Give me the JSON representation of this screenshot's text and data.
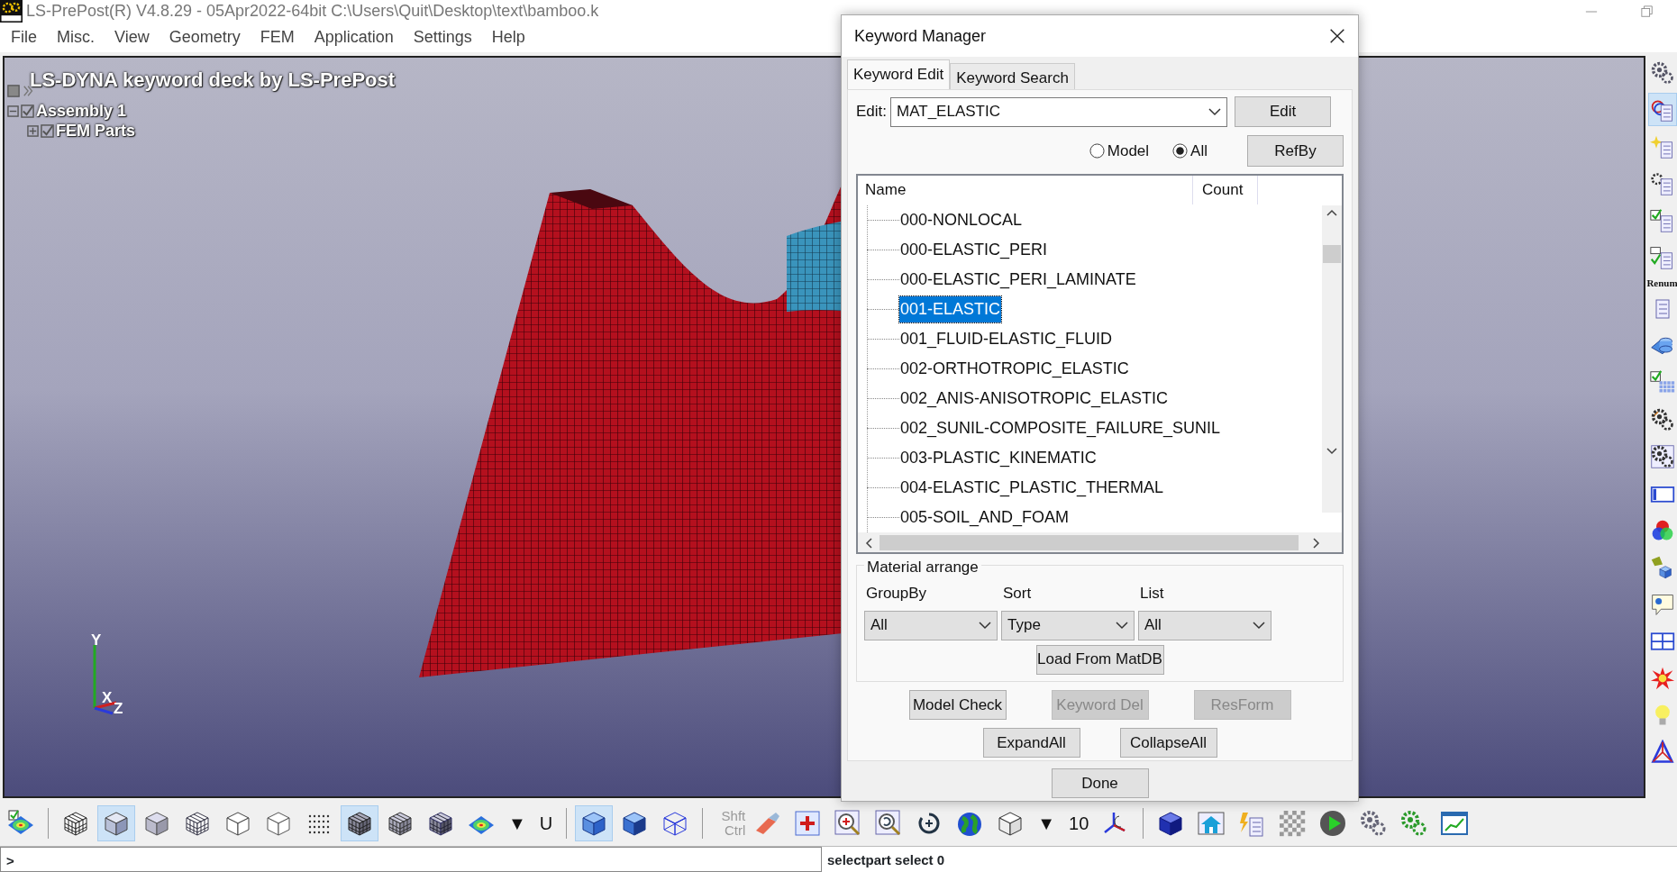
{
  "window": {
    "title": "LS-PrePost(R) V4.8.29 - 05Apr2022-64bit C:\\Users\\Quit\\Desktop\\text\\bamboo.k"
  },
  "menu": [
    "File",
    "Misc.",
    "View",
    "Geometry",
    "FEM",
    "Application",
    "Settings",
    "Help"
  ],
  "viewport": {
    "caption": "LS-DYNA keyword deck by LS-PrePost",
    "tree": [
      {
        "label": "Assembly 1",
        "checked": true,
        "expanded": true,
        "children": [
          {
            "label": "FEM Parts",
            "checked": true,
            "expanded": false
          }
        ]
      }
    ],
    "axes": [
      "Y",
      "X",
      "Z"
    ]
  },
  "right_toolbar": [
    {
      "kind": "icon",
      "selected": false
    },
    {
      "kind": "icon",
      "selected": true
    },
    {
      "kind": "icon",
      "selected": false
    },
    {
      "kind": "icon",
      "selected": false
    },
    {
      "kind": "icon",
      "selected": false
    },
    {
      "kind": "icon",
      "selected": false
    },
    {
      "kind": "text",
      "text": "Renum"
    },
    {
      "kind": "icon",
      "selected": false
    },
    {
      "kind": "icon",
      "selected": false
    },
    {
      "kind": "icon",
      "selected": false
    },
    {
      "kind": "icon",
      "selected": false
    },
    {
      "kind": "icon",
      "selected": false
    },
    {
      "kind": "icon",
      "selected": false
    },
    {
      "kind": "icon",
      "selected": false
    },
    {
      "kind": "icon",
      "selected": false
    },
    {
      "kind": "icon",
      "selected": false
    },
    {
      "kind": "icon",
      "selected": false
    },
    {
      "kind": "icon",
      "selected": false
    },
    {
      "kind": "icon",
      "selected": false
    },
    {
      "kind": "icon",
      "selected": false
    }
  ],
  "bottom_toolbar": [
    {
      "kind": "icon",
      "selected": false
    },
    {
      "kind": "separator"
    },
    {
      "kind": "icon",
      "selected": false
    },
    {
      "kind": "icon",
      "selected": true
    },
    {
      "kind": "icon",
      "selected": false
    },
    {
      "kind": "icon",
      "selected": false
    },
    {
      "kind": "icon",
      "selected": false
    },
    {
      "kind": "icon",
      "selected": false
    },
    {
      "kind": "icon",
      "selected": false
    },
    {
      "kind": "icon",
      "selected": true
    },
    {
      "kind": "icon",
      "selected": false
    },
    {
      "kind": "icon",
      "selected": false
    },
    {
      "kind": "icon",
      "selected": false
    },
    {
      "kind": "text",
      "text": "▼"
    },
    {
      "kind": "text",
      "text": "U"
    },
    {
      "kind": "separator"
    },
    {
      "kind": "icon",
      "selected": true
    },
    {
      "kind": "icon",
      "selected": false
    },
    {
      "kind": "icon",
      "selected": false
    },
    {
      "kind": "separator"
    },
    {
      "kind": "text",
      "text": "Shft Ctrl"
    },
    {
      "kind": "icon",
      "selected": false
    },
    {
      "kind": "icon",
      "selected": false
    },
    {
      "kind": "icon",
      "selected": false
    },
    {
      "kind": "icon",
      "selected": false
    },
    {
      "kind": "icon",
      "selected": false
    },
    {
      "kind": "icon",
      "selected": false
    },
    {
      "kind": "icon",
      "selected": false
    },
    {
      "kind": "text",
      "text": "▼"
    },
    {
      "kind": "text",
      "text": "10"
    },
    {
      "kind": "icon",
      "selected": false
    },
    {
      "kind": "separator"
    },
    {
      "kind": "icon",
      "selected": false
    },
    {
      "kind": "icon",
      "selected": false
    },
    {
      "kind": "icon",
      "selected": false
    },
    {
      "kind": "icon",
      "selected": false
    },
    {
      "kind": "icon",
      "selected": false
    },
    {
      "kind": "icon",
      "selected": false
    },
    {
      "kind": "icon",
      "selected": false
    },
    {
      "kind": "icon",
      "selected": false
    }
  ],
  "command_line": {
    "prompt": ">",
    "output": "selectpart select 0"
  },
  "dialog": {
    "title": "Keyword Manager",
    "tabs": [
      {
        "label": "Keyword Edit",
        "selected": true
      },
      {
        "label": "Keyword Search",
        "selected": false
      }
    ],
    "edit_label": "Edit:",
    "edit_value": "MAT_ELASTIC",
    "edit_button": "Edit",
    "scope": [
      {
        "label": "Model",
        "selected": false
      },
      {
        "label": "All",
        "selected": true
      }
    ],
    "refby_button": "RefBy",
    "list": {
      "columns": [
        "Name",
        "Count"
      ],
      "rows": [
        {
          "name": "000-NONLOCAL",
          "selected": false
        },
        {
          "name": "000-ELASTIC_PERI",
          "selected": false
        },
        {
          "name": "000-ELASTIC_PERI_LAMINATE",
          "selected": false
        },
        {
          "name": "001-ELASTIC",
          "selected": true
        },
        {
          "name": "001_FLUID-ELASTIC_FLUID",
          "selected": false
        },
        {
          "name": "002-ORTHOTROPIC_ELASTIC",
          "selected": false
        },
        {
          "name": "002_ANIS-ANISOTROPIC_ELASTIC",
          "selected": false
        },
        {
          "name": "002_SUNIL-COMPOSITE_FAILURE_SUNIL",
          "selected": false
        },
        {
          "name": "003-PLASTIC_KINEMATIC",
          "selected": false
        },
        {
          "name": "004-ELASTIC_PLASTIC_THERMAL",
          "selected": false
        },
        {
          "name": "005-SOIL_AND_FOAM",
          "selected": false
        }
      ]
    },
    "group_title": "Material arrange",
    "selects": [
      {
        "label": "GroupBy",
        "value": "All"
      },
      {
        "label": "Sort",
        "value": "Type"
      },
      {
        "label": "List",
        "value": "All"
      }
    ],
    "load_button": "Load From MatDB",
    "buttons": [
      {
        "label": "Model Check",
        "disabled": false
      },
      {
        "label": "Keyword Del",
        "disabled": true
      },
      {
        "label": "ResForm",
        "disabled": true
      },
      {
        "label": "ExpandAll",
        "disabled": false
      },
      {
        "label": "CollapseAll",
        "disabled": false
      }
    ],
    "done_button": "Done"
  }
}
